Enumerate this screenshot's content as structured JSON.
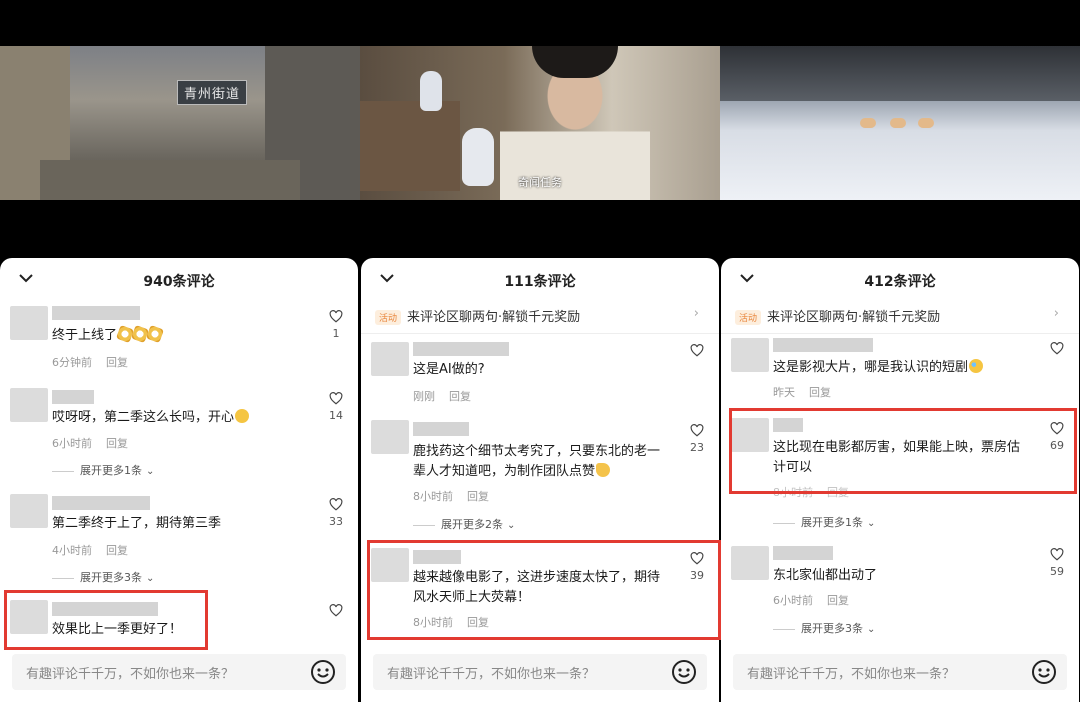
{
  "frames": {
    "sign_text": "青州街道",
    "watermark": "奇闻任务"
  },
  "panels": [
    {
      "title": "940条评论",
      "comments": [
        {
          "text": "终于上线了",
          "time": "6分钟前",
          "reply": "回复",
          "likes": "1"
        },
        {
          "text": "哎呀呀，第二季这么长吗，开心",
          "time": "6小时前",
          "reply": "回复",
          "likes": "14",
          "expand": "展开更多1条"
        },
        {
          "text": "第二季终于上了，期待第三季",
          "time": "4小时前",
          "reply": "回复",
          "likes": "33",
          "expand": "展开更多3条"
        },
        {
          "text": "效果比上一季更好了！",
          "likes": ""
        }
      ],
      "input_placeholder": "有趣评论千千万，不如你也来一条？"
    },
    {
      "title": "111条评论",
      "banner": {
        "tag": "活动",
        "text": "来评论区聊两句·解锁千元奖励"
      },
      "comments": [
        {
          "text": "这是AI做的?",
          "time": "刚刚",
          "reply": "回复",
          "likes": ""
        },
        {
          "text": "鹿找药这个细节太考究了，只要东北的老一辈人才知道吧，为制作团队点赞",
          "time": "8小时前",
          "reply": "回复",
          "likes": "23",
          "expand": "展开更多2条"
        },
        {
          "text": "越来越像电影了，这进步速度太快了，期待风水天师上大荧幕！",
          "time": "8小时前",
          "reply": "回复",
          "likes": "39"
        }
      ],
      "input_placeholder": "有趣评论千千万，不如你也来一条？"
    },
    {
      "title": "412条评论",
      "banner": {
        "tag": "活动",
        "text": "来评论区聊两句·解锁千元奖励"
      },
      "comments": [
        {
          "text": "这是影视大片，哪是我认识的短剧",
          "time": "昨天",
          "reply": "回复",
          "likes": ""
        },
        {
          "text": "这比现在电影都厉害，如果能上映，票房估计可以",
          "time": "8小时前",
          "reply": "回复",
          "likes": "69",
          "expand": "展开更多1条"
        },
        {
          "text": "东北家仙都出动了",
          "time": "6小时前",
          "reply": "回复",
          "likes": "59",
          "expand": "展开更多3条"
        }
      ],
      "input_placeholder": "有趣评论千千万，不如你也来一条？"
    }
  ],
  "colors": {
    "highlight": "#e23a31",
    "tag_orange": "#e8843a"
  }
}
